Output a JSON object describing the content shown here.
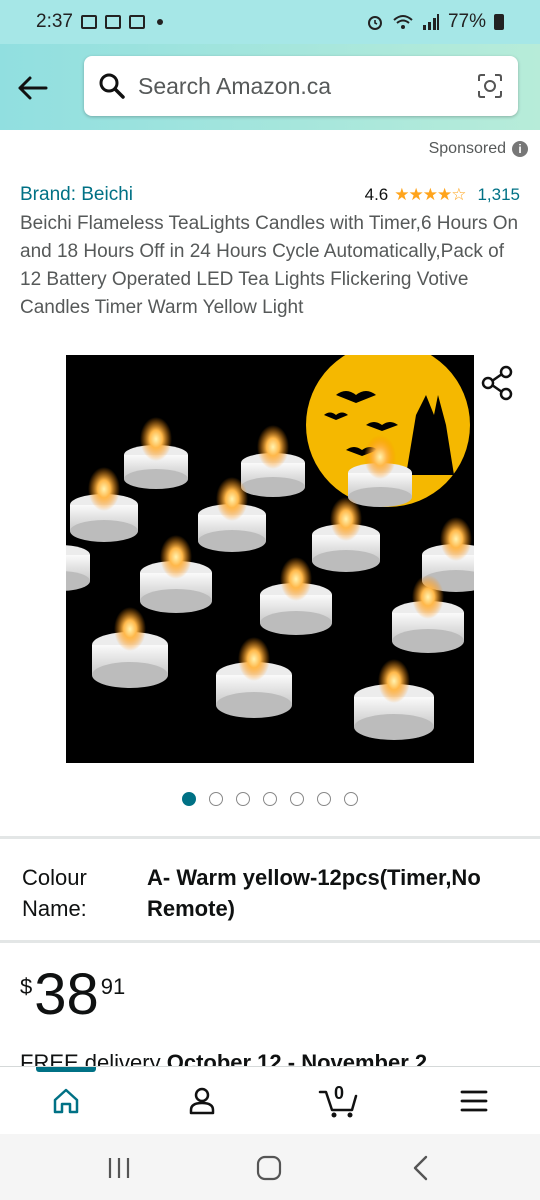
{
  "status_bar": {
    "time": "2:37",
    "battery": "77%"
  },
  "search": {
    "placeholder": "Search Amazon.ca"
  },
  "sponsored": {
    "label": "Sponsored",
    "info_glyph": "i"
  },
  "product": {
    "brand": "Brand: Beichi",
    "rating": "4.6",
    "stars": "★★★★☆",
    "review_count": "1,315",
    "title": "Beichi Flameless TeaLights Candles with Timer,6 Hours On and 18 Hours Off in 24 Hours Cycle Automatically,Pack of 12 Battery Operated LED Tea Lights Flickering Votive Candles Timer Warm Yellow Light",
    "image_count": 7,
    "active_image_index": 0
  },
  "variant": {
    "label": "Colour Name:",
    "value": "A- Warm yellow-12pcs(Timer,No Remote)"
  },
  "price": {
    "symbol": "$",
    "whole": "38",
    "fraction": "91"
  },
  "delivery": {
    "prefix": "FREE delivery ",
    "dates": "October 12 - November 2"
  },
  "bottom_nav": {
    "items": [
      "home-icon",
      "account-icon",
      "cart-icon",
      "menu-icon"
    ],
    "cart_count": "0",
    "active": "home"
  },
  "colors": {
    "accent": "#007185",
    "star": "#ffa41c",
    "header_start": "#91dfe0",
    "header_end": "#b7ecd9"
  }
}
